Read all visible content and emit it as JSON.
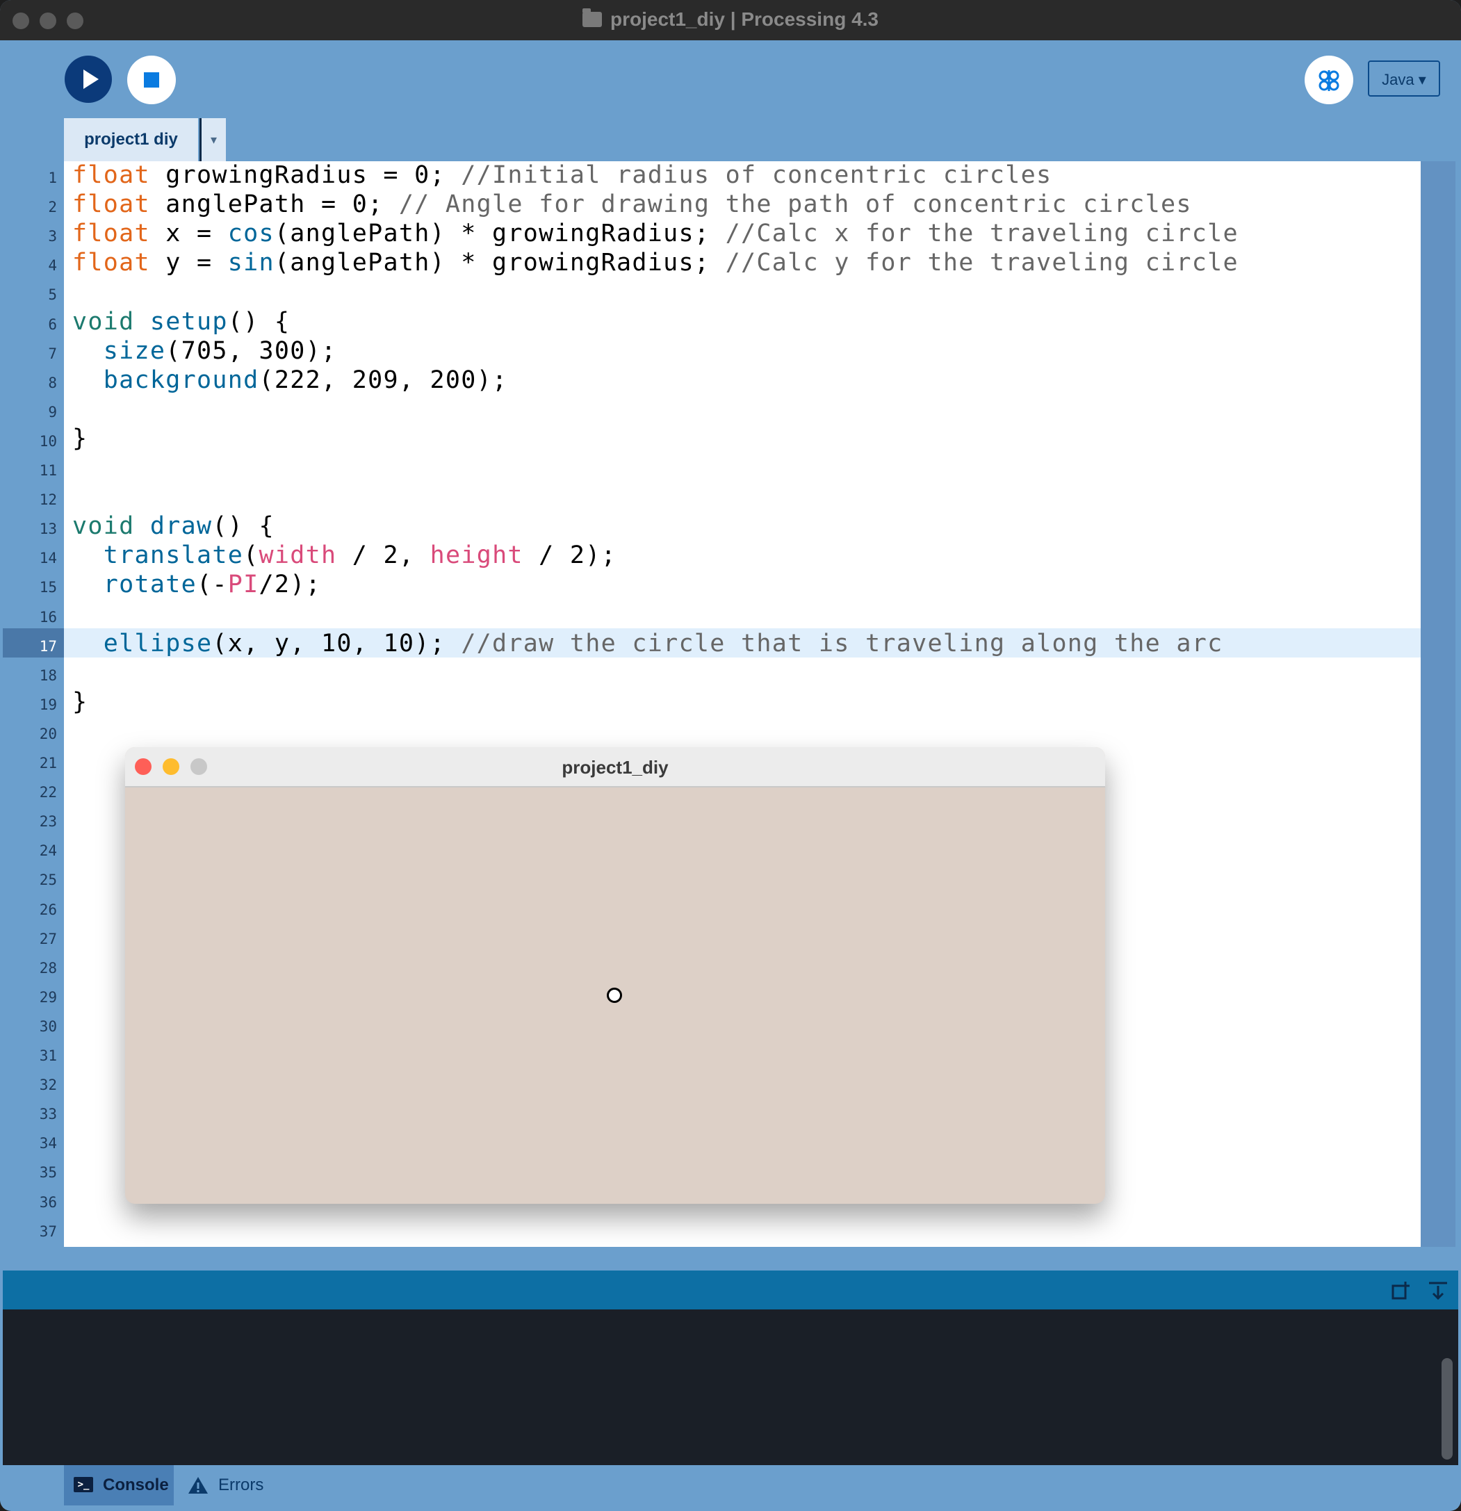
{
  "window": {
    "title": "project1_diy | Processing 4.3"
  },
  "toolbar": {
    "mode_label": "Java ▾"
  },
  "tabs": [
    {
      "label": "project1 diy",
      "menu": "▾"
    }
  ],
  "editor": {
    "current_line": 17,
    "line_numbers": [
      "1",
      "2",
      "3",
      "4",
      "5",
      "6",
      "7",
      "8",
      "9",
      "10",
      "11",
      "12",
      "13",
      "14",
      "15",
      "16",
      "17",
      "18",
      "19",
      "20",
      "21",
      "22",
      "23",
      "24",
      "25",
      "26",
      "27",
      "28",
      "29",
      "30",
      "31",
      "32",
      "33",
      "34",
      "35",
      "36",
      "37"
    ],
    "lines": [
      [
        {
          "t": "float",
          "c": "kw"
        },
        {
          "t": " growingRadius = 0; "
        },
        {
          "t": "//Initial radius of concentric circles",
          "c": "cm"
        }
      ],
      [
        {
          "t": "float",
          "c": "kw"
        },
        {
          "t": " anglePath = 0; "
        },
        {
          "t": "// Angle for drawing the path of concentric circles",
          "c": "cm"
        }
      ],
      [
        {
          "t": "float",
          "c": "kw"
        },
        {
          "t": " x = "
        },
        {
          "t": "cos",
          "c": "fn"
        },
        {
          "t": "(anglePath) * growingRadius; "
        },
        {
          "t": "//Calc x for the traveling circle",
          "c": "cm"
        }
      ],
      [
        {
          "t": "float",
          "c": "kw"
        },
        {
          "t": " y = "
        },
        {
          "t": "sin",
          "c": "fn"
        },
        {
          "t": "(anglePath) * growingRadius; "
        },
        {
          "t": "//Calc y for the traveling circle",
          "c": "cm"
        }
      ],
      [],
      [
        {
          "t": "void",
          "c": "kw2"
        },
        {
          "t": " "
        },
        {
          "t": "setup",
          "c": "fn"
        },
        {
          "t": "() {"
        }
      ],
      [
        {
          "t": "  "
        },
        {
          "t": "size",
          "c": "fn"
        },
        {
          "t": "(705, 300);"
        }
      ],
      [
        {
          "t": "  "
        },
        {
          "t": "background",
          "c": "fn"
        },
        {
          "t": "(222, 209, 200);"
        }
      ],
      [],
      [
        {
          "t": "}"
        }
      ],
      [],
      [],
      [
        {
          "t": "void",
          "c": "kw2"
        },
        {
          "t": " "
        },
        {
          "t": "draw",
          "c": "fn"
        },
        {
          "t": "() {"
        }
      ],
      [
        {
          "t": "  "
        },
        {
          "t": "translate",
          "c": "fn"
        },
        {
          "t": "("
        },
        {
          "t": "width",
          "c": "cn"
        },
        {
          "t": " / 2, "
        },
        {
          "t": "height",
          "c": "cn"
        },
        {
          "t": " / 2);"
        }
      ],
      [
        {
          "t": "  "
        },
        {
          "t": "rotate",
          "c": "fn"
        },
        {
          "t": "(-"
        },
        {
          "t": "PI",
          "c": "cn"
        },
        {
          "t": "/2);"
        }
      ],
      [],
      [
        {
          "t": "  "
        },
        {
          "t": "ellipse",
          "c": "fn"
        },
        {
          "t": "(x, y, 10, 10); "
        },
        {
          "t": "//draw the circle that is traveling along the arc",
          "c": "cm"
        }
      ],
      [],
      [
        {
          "t": "}"
        }
      ]
    ]
  },
  "sketch_window": {
    "title": "project1_diy",
    "background": "#ddd0c7"
  },
  "console_tabs": {
    "console_label": "Console",
    "errors_label": "Errors"
  },
  "colors": {
    "accent": "#6b9fcd",
    "run": "#0b3a7a",
    "keyword": "#e2661a",
    "function": "#006699",
    "comment": "#666666",
    "constant": "#d94a7a"
  }
}
